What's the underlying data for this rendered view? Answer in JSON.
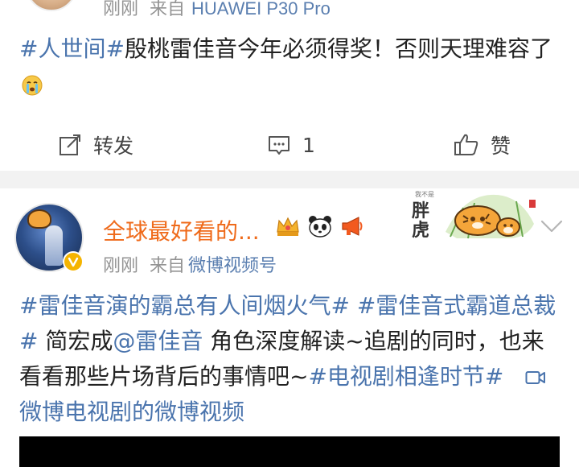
{
  "post1": {
    "time": "刚刚",
    "source_prefix": "来自",
    "device": "HUAWEI P30 Pro",
    "topic": "#人世间#",
    "text": "殷桃雷佳音今年必须得奖！否则天理难容了",
    "emoji_icon": "crying-face-icon",
    "actions": {
      "repost_label": "转发",
      "comment_count": "1",
      "like_label": "赞"
    }
  },
  "post2": {
    "username": "全球最好看的...",
    "time": "刚刚",
    "source_prefix": "来自",
    "source": "微博视频号",
    "badge_icons": [
      "crown-icon",
      "panda-icon",
      "megaphone-icon"
    ],
    "decor": {
      "title": "胖虎",
      "caption": "我不是"
    },
    "segments": {
      "topic1": "#雷佳音演的霸总有人间烟火气#",
      "topic2": "#雷佳音式霸道总裁#",
      "plain1": " 简宏成",
      "mention": "@雷佳音",
      "plain2": " 角色深度解读~追剧的同时，也来看看那些片场背后的事情吧~",
      "topic3": "#电视剧相逢时节#",
      "video_link": "微博电视剧的微博视频"
    }
  },
  "colors": {
    "link": "#4a74ad",
    "username": "#ef6a1a",
    "meta": "#939393",
    "divider": "#f2f2f2",
    "verified_badge": "#f5b400"
  }
}
